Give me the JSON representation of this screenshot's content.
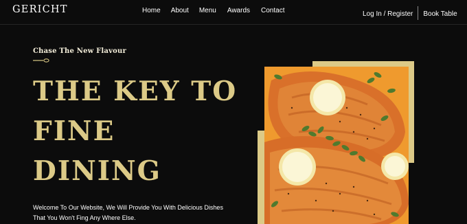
{
  "brand": {
    "logo": "GERICHT"
  },
  "nav": {
    "links": [
      "Home",
      "About",
      "Menu",
      "Awards",
      "Contact"
    ],
    "login": "Log In / Register",
    "book": "Book Table"
  },
  "hero": {
    "subtitle": "Chase The New Flavour",
    "headline": [
      "THE KEY TO",
      "FINE",
      "DINING"
    ],
    "description": [
      "Welcome To Our Website, We Will Provide You With Delicious Dishes",
      "That You Won't Fing Any Where Else."
    ]
  },
  "colors": {
    "accent": "#dcca87",
    "background": "#0c0c0c",
    "text": "#ffffff"
  },
  "image": {
    "icon": "salmon-dish-photo"
  }
}
